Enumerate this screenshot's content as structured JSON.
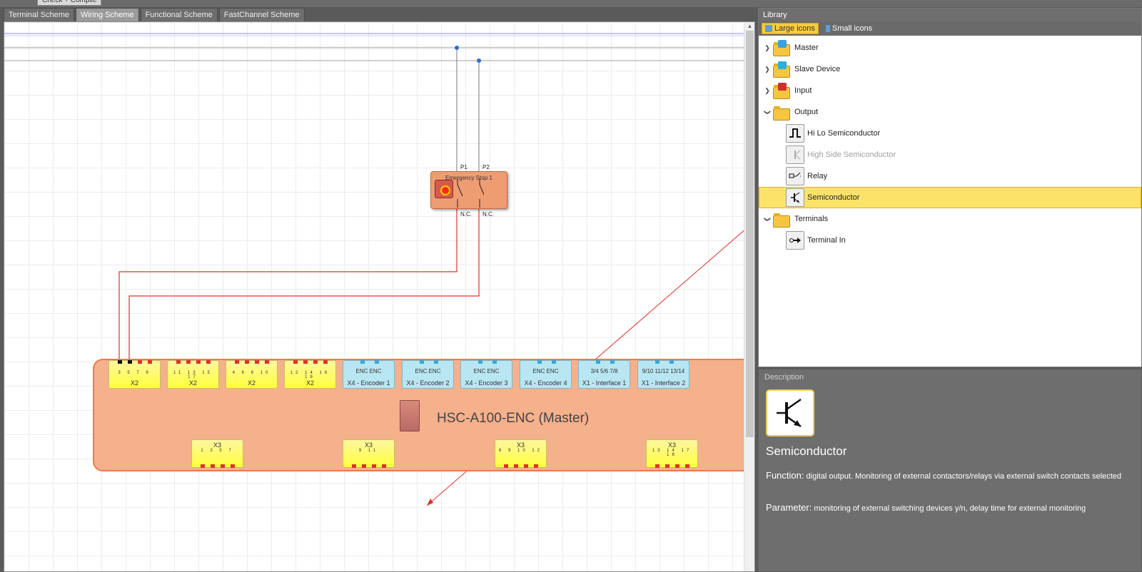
{
  "window": {
    "compile_label": "Check + Compile"
  },
  "tabs": [
    "Terminal Scheme",
    "Wiring Scheme",
    "Functional Scheme",
    "FastChannel Scheme"
  ],
  "canvas": {
    "emergency_stop": {
      "label": "Emergency Stop 1",
      "pin_top_1": "P1",
      "pin_top_2": "P2",
      "pin_bottom_1": "N.C.",
      "pin_bottom_2": "N.C."
    },
    "master": {
      "name": "HSC-A100-ENC (Master)",
      "top_connectors": [
        {
          "name": "X2",
          "kind": "yellow",
          "pins": "3 5 7 9"
        },
        {
          "name": "X2",
          "kind": "yellow",
          "pins": "11 13 15 17"
        },
        {
          "name": "X2",
          "kind": "yellow",
          "pins": "4 6 8 10"
        },
        {
          "name": "X2",
          "kind": "yellow",
          "pins": "12 14 16 18"
        },
        {
          "name": "X4 - Encoder 1",
          "kind": "blue",
          "pins": "ENC  ENC"
        },
        {
          "name": "X4 - Encoder 2",
          "kind": "blue",
          "pins": "ENC  ENC"
        },
        {
          "name": "X4 - Encoder 3",
          "kind": "blue",
          "pins": "ENC  ENC"
        },
        {
          "name": "X4 - Encoder 4",
          "kind": "blue",
          "pins": "ENC  ENC"
        },
        {
          "name": "X1 - Interface 1",
          "kind": "blue",
          "pins": "3/4  5/6  7/8"
        },
        {
          "name": "X1 - Interface 2",
          "kind": "blue",
          "pins": "9/10 11/12 13/14"
        }
      ],
      "bottom_connectors": [
        {
          "name": "X3",
          "pins": "1 3 5 7"
        },
        {
          "name": "X3",
          "pins": "9 11"
        },
        {
          "name": "X3",
          "pins": "8 9 10 12"
        },
        {
          "name": "X3",
          "pins": "13 14 17 18"
        }
      ]
    }
  },
  "library": {
    "title": "Library",
    "large_icons": "Large icons",
    "small_icons": "Small icons",
    "tree": [
      {
        "label": "Master",
        "level": 0,
        "expanded": false,
        "type": "folder",
        "icon": "master-icon",
        "color": "#3aa0e0"
      },
      {
        "label": "Slave Device",
        "level": 0,
        "expanded": false,
        "type": "folder",
        "icon": "slave-device-icon",
        "color": "#2ab0d8"
      },
      {
        "label": "Input",
        "level": 0,
        "expanded": false,
        "type": "folder",
        "icon": "input-icon",
        "color": "#d0302a"
      },
      {
        "label": "Output",
        "level": 0,
        "expanded": true,
        "type": "folder",
        "icon": "output-icon",
        "color": ""
      },
      {
        "label": "Hi Lo Semiconductor",
        "level": 1,
        "type": "item",
        "icon": "hi-lo-semiconductor-icon"
      },
      {
        "label": "High Side Semiconductor",
        "level": 1,
        "type": "item",
        "icon": "high-side-semiconductor-icon",
        "disabled": true
      },
      {
        "label": "Relay",
        "level": 1,
        "type": "item",
        "icon": "relay-icon"
      },
      {
        "label": "Semiconductor",
        "level": 1,
        "type": "item",
        "icon": "semiconductor-icon",
        "selected": true
      },
      {
        "label": "Terminals",
        "level": 0,
        "expanded": true,
        "type": "folder",
        "icon": "terminals-icon",
        "color": ""
      },
      {
        "label": "Terminal In",
        "level": 1,
        "type": "item",
        "icon": "terminal-in-icon"
      }
    ]
  },
  "description": {
    "header": "Description",
    "name": "Semiconductor",
    "function_label": "Function:",
    "function_text": "digital output. Monitoring of external contactors/relays via external switch contacts selected",
    "parameter_label": "Parameter:",
    "parameter_text": "monitoring of external switching devices y/n, delay time for external monitoring"
  },
  "colors": {
    "wire": "#e0302a",
    "selection": "#fbe36a",
    "master_fill": "#f5b08c",
    "master_border": "#ef7a48"
  }
}
